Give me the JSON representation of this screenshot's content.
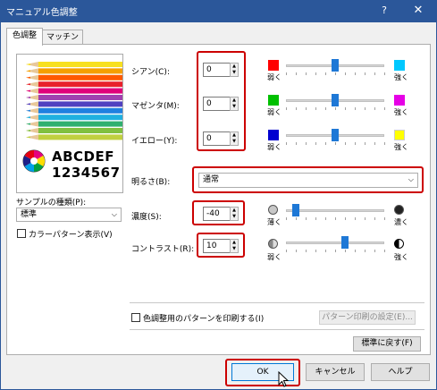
{
  "window": {
    "title": "マニュアル色調整",
    "help": "?",
    "close": "✕"
  },
  "tabs": [
    {
      "label": "色調整"
    },
    {
      "label": "マッチング"
    }
  ],
  "preview": {
    "text1": "ABCDEF",
    "text2": "1234567"
  },
  "sample_type": {
    "label": "サンプルの種類(P):",
    "value": "標準"
  },
  "color_pattern_check": {
    "label": "カラーパターン表示(V)",
    "checked": false
  },
  "cyan": {
    "label": "シアン(C):",
    "value": "0",
    "weak": "弱く",
    "strong": "強く",
    "level": 0
  },
  "magenta": {
    "label": "マゼンタ(M):",
    "value": "0",
    "weak": "弱く",
    "strong": "強く",
    "level": 0
  },
  "yellow": {
    "label": "イエロー(Y):",
    "value": "0",
    "weak": "弱く",
    "strong": "強く",
    "level": 0
  },
  "brightness": {
    "label": "明るさ(B):",
    "value": "通常"
  },
  "density": {
    "label": "濃度(S):",
    "value": "-40",
    "weak": "薄く",
    "strong": "濃く",
    "level": -40
  },
  "contrast": {
    "label": "コントラスト(R):",
    "value": "10",
    "weak": "弱く",
    "strong": "強く",
    "level": 10
  },
  "print_pattern": {
    "label": "色調整用のパターンを印刷する(I)",
    "settings_button": "パターン印刷の設定(E)...",
    "checked": false
  },
  "reset_button": "標準に戻す(F)",
  "buttons": {
    "ok": "OK",
    "cancel": "キャンセル",
    "help": "ヘルプ"
  },
  "colors": {
    "cyan": "#00c8ff",
    "magenta": "#e600e6",
    "yellow": "#ffff00",
    "red": "#ff0000",
    "green": "#00c000",
    "blue": "#0000d0",
    "accent": "#1e78d6",
    "highlight": "#cc0000"
  }
}
